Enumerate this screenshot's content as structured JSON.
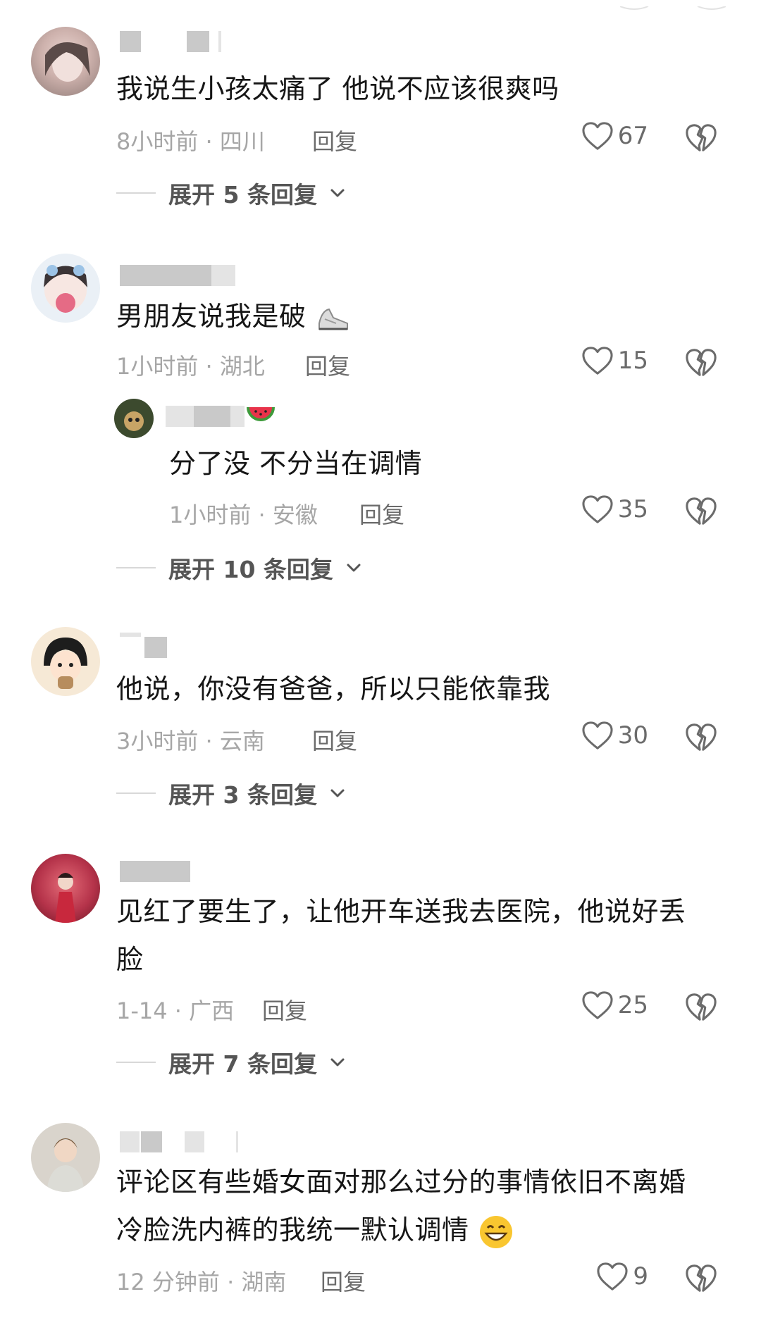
{
  "comments": [
    {
      "text": "我说生小孩太痛了 他说不应该很爽吗",
      "meta": "8小时前 · 四川",
      "reply_label": "回复",
      "likes": "67",
      "expand": "展开 5 条回复"
    },
    {
      "text": "男朋友说我是破",
      "meta": "1小时前 · 湖北",
      "reply_label": "回复",
      "likes": "15",
      "sub_reply": {
        "text": "分了没 不分当在调情",
        "meta": "1小时前 · 安徽",
        "reply_label": "回复",
        "likes": "35"
      },
      "expand": "展开 10 条回复"
    },
    {
      "text": "他说，你没有爸爸，所以只能依靠我",
      "meta": "3小时前 · 云南",
      "reply_label": "回复",
      "likes": "30",
      "expand": "展开 3 条回复"
    },
    {
      "text_line1": "见红了要生了，让他开车送我去医院，他说好丢",
      "text_line2": "脸",
      "meta": "1-14 · 广西",
      "reply_label": "回复",
      "likes": "25",
      "expand": "展开 7 条回复"
    },
    {
      "text_line1": "评论区有些婚女面对那么过分的事情依旧不离婚",
      "text_line2": "冷脸洗内裤的我统一默认调情",
      "meta": "12 分钟前 · 湖南",
      "reply_label": "回复",
      "likes": "9"
    }
  ],
  "icons": {
    "like": "heart-outline-icon",
    "dislike": "broken-heart-icon",
    "expand": "chevron-down-icon",
    "shoe": "sneaker-emoji",
    "watermelon": "watermelon-emoji",
    "grin": "grinning-emoji"
  }
}
